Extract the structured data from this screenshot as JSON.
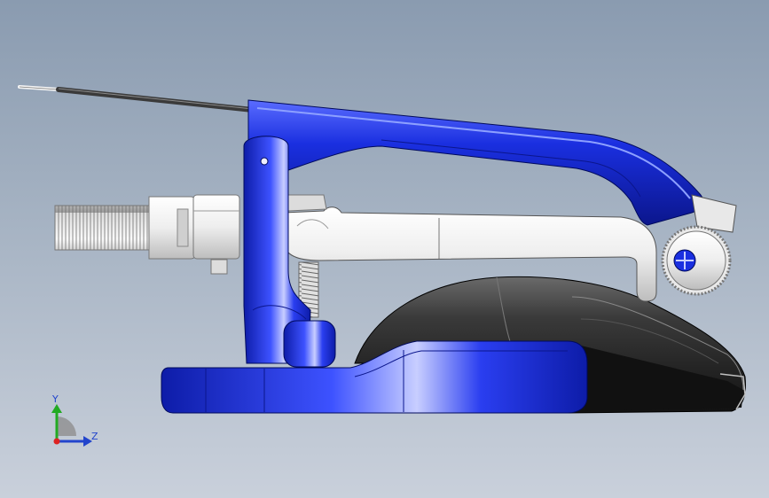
{
  "triad": {
    "y_label": "Y",
    "z_label": "Z",
    "y_color": "#22aa22",
    "z_color": "#2244cc",
    "origin_color": "#dd2222"
  },
  "colors": {
    "part_blue": "#1a2fe0",
    "part_white": "#f2f2f2",
    "part_black": "#1c1c1c",
    "background_top": "#8a9bb0",
    "background_bottom": "#c9d0db"
  }
}
